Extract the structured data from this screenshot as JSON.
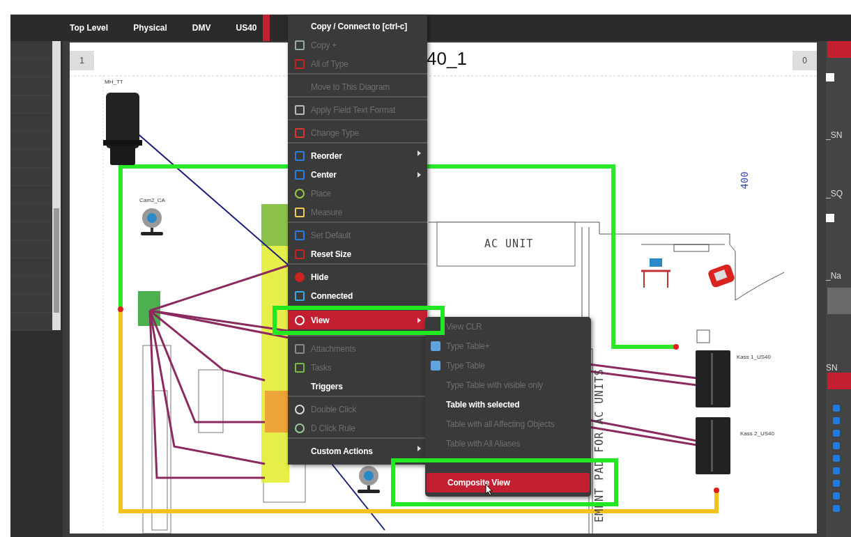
{
  "tabs": [
    {
      "label": "Top Level",
      "selected": false
    },
    {
      "label": "Physical",
      "selected": false
    },
    {
      "label": "DMV",
      "selected": false
    },
    {
      "label": "US40",
      "selected": true
    }
  ],
  "canvas": {
    "page_number": "1",
    "title": "40_1",
    "counter": "0",
    "labels": [
      "MH_TT",
      "Cam2_CA",
      "Kass 1_US40",
      "Kass 2_US40"
    ],
    "dimension": "400",
    "ac_unit": "AC UNIT",
    "vertical_note": "EMENT PAD FOR AC UNITS"
  },
  "context_menu": {
    "items": [
      {
        "label": "Copy / Connect to [ctrl-c]",
        "disabled": false,
        "submenu": false,
        "selected": false,
        "divider_above": false
      },
      {
        "label": "Copy +",
        "disabled": true,
        "submenu": false,
        "selected": false,
        "divider_above": false
      },
      {
        "label": "All of Type",
        "disabled": true,
        "submenu": false,
        "selected": false,
        "divider_above": false
      },
      {
        "label": "Move to This Diagram",
        "disabled": true,
        "submenu": false,
        "selected": false,
        "divider_above": true
      },
      {
        "label": "Apply Field Text Format",
        "disabled": true,
        "submenu": false,
        "selected": false,
        "divider_above": true
      },
      {
        "label": "Change Type",
        "disabled": true,
        "submenu": false,
        "selected": false,
        "divider_above": true
      },
      {
        "label": "Reorder",
        "disabled": false,
        "submenu": true,
        "selected": false,
        "divider_above": true
      },
      {
        "label": "Center",
        "disabled": false,
        "submenu": true,
        "selected": false,
        "divider_above": false
      },
      {
        "label": "Place",
        "disabled": true,
        "submenu": false,
        "selected": false,
        "divider_above": false
      },
      {
        "label": "Measure",
        "disabled": true,
        "submenu": false,
        "selected": false,
        "divider_above": false
      },
      {
        "label": "Set Default",
        "disabled": true,
        "submenu": false,
        "selected": false,
        "divider_above": true
      },
      {
        "label": "Reset Size",
        "disabled": false,
        "submenu": false,
        "selected": false,
        "divider_above": false
      },
      {
        "label": "Hide",
        "disabled": false,
        "submenu": false,
        "selected": false,
        "divider_above": true
      },
      {
        "label": "Connected",
        "disabled": false,
        "submenu": false,
        "selected": false,
        "divider_above": false
      },
      {
        "label": "View",
        "disabled": false,
        "submenu": true,
        "selected": true,
        "divider_above": false
      },
      {
        "label": "Attachments",
        "disabled": true,
        "submenu": false,
        "selected": false,
        "divider_above": true
      },
      {
        "label": "Tasks",
        "disabled": true,
        "submenu": false,
        "selected": false,
        "divider_above": false
      },
      {
        "label": "Triggers",
        "disabled": false,
        "submenu": false,
        "selected": false,
        "divider_above": false
      },
      {
        "label": "Double Click",
        "disabled": true,
        "submenu": false,
        "selected": false,
        "divider_above": true
      },
      {
        "label": "D Click Rule",
        "disabled": true,
        "submenu": false,
        "selected": false,
        "divider_above": false
      },
      {
        "label": "Custom Actions",
        "disabled": false,
        "submenu": true,
        "selected": false,
        "divider_above": true
      }
    ]
  },
  "submenu": {
    "items": [
      {
        "label": "View CLR",
        "disabled": true,
        "selected": false
      },
      {
        "label": "Type Table+",
        "disabled": true,
        "selected": false
      },
      {
        "label": "Type Table",
        "disabled": true,
        "selected": false
      },
      {
        "label": "Type Table with visible only",
        "disabled": true,
        "selected": false
      },
      {
        "label": "Table with selected",
        "disabled": false,
        "selected": false
      },
      {
        "label": "Table with all Affecting Objects",
        "disabled": true,
        "selected": false
      },
      {
        "label": "Table with All Aliases",
        "disabled": true,
        "selected": false
      },
      {
        "label": "Composite View",
        "disabled": false,
        "selected": true
      }
    ]
  },
  "right_panel": {
    "rows": [
      {
        "kind": "bar"
      },
      {
        "kind": "checkbox",
        "checked": false
      },
      {
        "kind": "label",
        "text": "_SN"
      },
      {
        "kind": "label",
        "text": "_SQ"
      },
      {
        "kind": "checkbox",
        "checked": false
      },
      {
        "kind": "label",
        "text": "_Na"
      },
      {
        "kind": "band"
      },
      {
        "kind": "label",
        "text": "SN"
      },
      {
        "kind": "bar"
      }
    ],
    "checks": [
      {
        "checked": true
      },
      {
        "checked": true
      },
      {
        "checked": true
      },
      {
        "checked": true
      },
      {
        "checked": true
      },
      {
        "checked": true
      },
      {
        "checked": true
      },
      {
        "checked": true
      },
      {
        "checked": true
      }
    ]
  }
}
